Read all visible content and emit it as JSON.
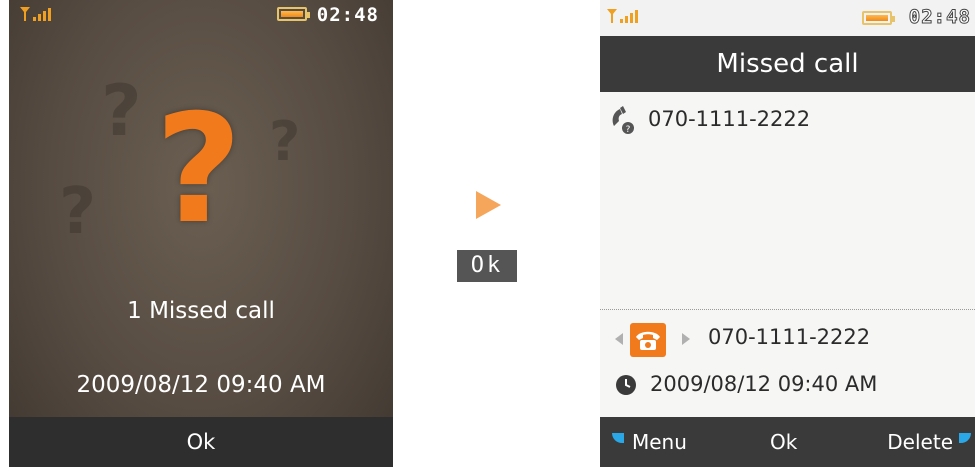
{
  "left": {
    "time": "02:48",
    "missed_text": "1 Missed call",
    "datetime": "2009/08/12 09:40 AM",
    "softkey": "Ok"
  },
  "transition": {
    "key_label": "Ok"
  },
  "right": {
    "time": "02:48",
    "title": "Missed call",
    "number": "070-1111-2222",
    "detail_number": "070-1111-2222",
    "detail_datetime": "2009/08/12  09:40 AM",
    "softkeys": {
      "menu": "Menu",
      "ok": "Ok",
      "delete": "Delete"
    }
  },
  "colors": {
    "accent": "#f07a1c",
    "softkey_marker": "#2aa7e6",
    "bar_bg": "#3a3a3a"
  },
  "icons": [
    "signal-icon",
    "battery-icon",
    "question-mark-icon",
    "arrow-right-icon",
    "handset-missed-icon",
    "phone-icon",
    "clock-icon"
  ]
}
